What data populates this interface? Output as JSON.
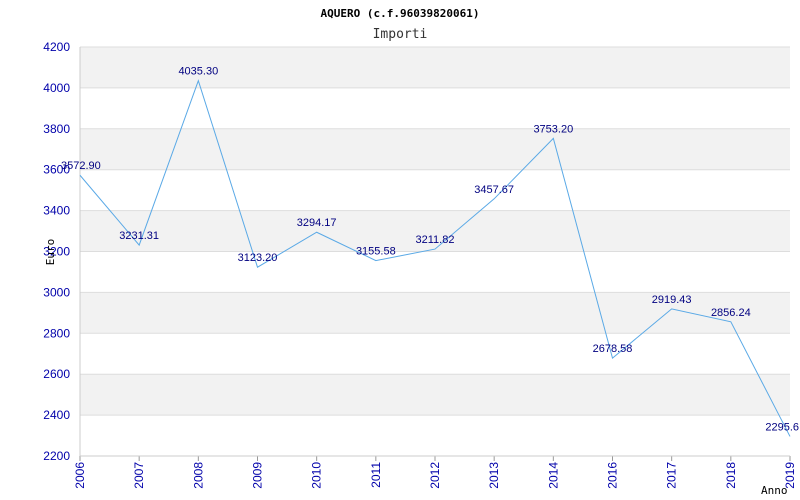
{
  "chart_data": {
    "type": "line",
    "title": "AQUERO (c.f.96039820061)",
    "subtitle": "Importi",
    "xlabel": "Anno",
    "ylabel": "Euro",
    "ylim": [
      2200,
      4200
    ],
    "yticks": [
      "2200",
      "2400",
      "2600",
      "2800",
      "3000",
      "3200",
      "3400",
      "3600",
      "3800",
      "4000",
      "4200"
    ],
    "categories": [
      "2006",
      "2007",
      "2008",
      "2009",
      "2010",
      "2011",
      "2012",
      "2013",
      "2014",
      "2016",
      "2017",
      "2018",
      "2019"
    ],
    "values": [
      3572.9,
      3231.31,
      4035.3,
      3123.2,
      3294.17,
      3155.58,
      3211.82,
      3457.67,
      3753.2,
      2678.58,
      2919.43,
      2856.24,
      2295.6
    ],
    "value_labels": [
      "3572.90",
      "3231.31",
      "4035.30",
      "3123.20",
      "3294.17",
      "3155.58",
      "3211.82",
      "3457.67",
      "3753.20",
      "2678.58",
      "2919.43",
      "2856.24",
      "2295.6"
    ],
    "grid": true,
    "colors": {
      "line": "#5aa9e6",
      "band": "#f2f2f2",
      "gridline": "#dddddd",
      "tick": "#0000aa",
      "data_label": "#000080"
    }
  }
}
